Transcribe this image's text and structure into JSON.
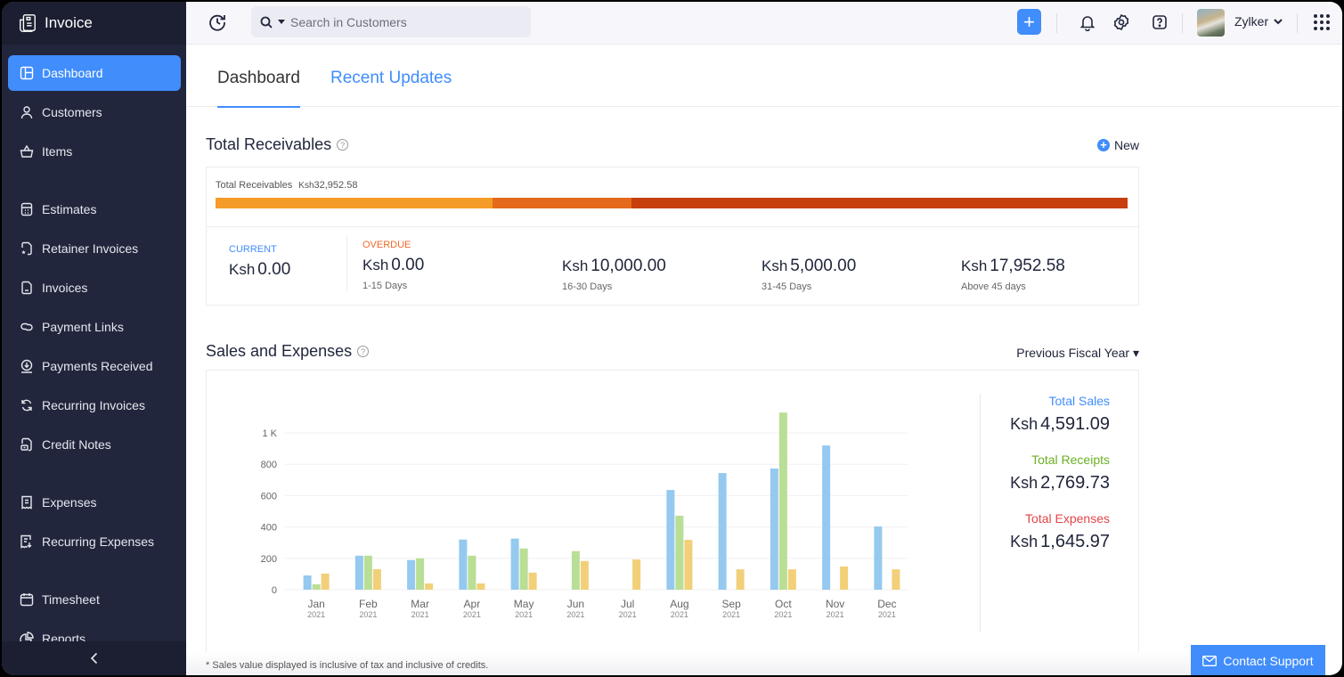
{
  "app": {
    "title": "Invoice"
  },
  "sidebar": {
    "items": [
      {
        "label": "Dashboard",
        "icon": "dashboard-icon",
        "active": true
      },
      {
        "label": "Customers",
        "icon": "user-icon"
      },
      {
        "label": "Items",
        "icon": "basket-icon"
      },
      {
        "label": "Estimates",
        "icon": "calculator-icon"
      },
      {
        "label": "Retainer Invoices",
        "icon": "retainer-invoice-icon"
      },
      {
        "label": "Invoices",
        "icon": "document-icon"
      },
      {
        "label": "Payment Links",
        "icon": "link-icon"
      },
      {
        "label": "Payments Received",
        "icon": "payment-received-icon"
      },
      {
        "label": "Recurring Invoices",
        "icon": "recurring-icon"
      },
      {
        "label": "Credit Notes",
        "icon": "credit-note-icon"
      },
      {
        "label": "Expenses",
        "icon": "receipt-icon"
      },
      {
        "label": "Recurring Expenses",
        "icon": "recurring-receipt-icon"
      },
      {
        "label": "Timesheet",
        "icon": "calendar-icon"
      },
      {
        "label": "Reports",
        "icon": "pie-chart-icon"
      }
    ],
    "collapse_label": "‹"
  },
  "topbar": {
    "search_placeholder": "Search in Customers",
    "org_name": "Zylker",
    "icons": [
      "history-icon",
      "search-icon",
      "plus-icon",
      "bell-icon",
      "gear-icon",
      "help-icon",
      "apps-grid-icon"
    ]
  },
  "tabs": [
    {
      "label": "Dashboard",
      "active": true
    },
    {
      "label": "Recent Updates",
      "active": false
    }
  ],
  "receivables": {
    "title": "Total Receivables",
    "new_label": "New",
    "total_label": "Total Receivables",
    "currency": "Ksh",
    "total_value": "32,952.58",
    "bar_segments": [
      {
        "name": "current-to-30",
        "fraction": 0.304,
        "color": "#f59b28"
      },
      {
        "name": "31-45",
        "fraction": 0.152,
        "color": "#e4691b"
      },
      {
        "name": "above-45",
        "fraction": 0.544,
        "color": "#c63f0c"
      }
    ],
    "current": {
      "label": "CURRENT",
      "currency": "Ksh",
      "value": "0.00",
      "color": "#408dfb"
    },
    "overdue_label": "OVERDUE",
    "overdue_color": "#f06a29",
    "buckets": [
      {
        "currency": "Ksh",
        "value": "0.00",
        "range": "1-15 Days"
      },
      {
        "currency": "Ksh",
        "value": "10,000.00",
        "range": "16-30 Days"
      },
      {
        "currency": "Ksh",
        "value": "5,000.00",
        "range": "31-45 Days"
      },
      {
        "currency": "Ksh",
        "value": "17,952.58",
        "range": "Above 45 days"
      }
    ]
  },
  "sales_expenses": {
    "title": "Sales and Expenses",
    "period": "Previous Fiscal Year ▾",
    "totals": [
      {
        "label": "Total Sales",
        "currency": "Ksh",
        "value": "4,591.09",
        "color": "#408dfb"
      },
      {
        "label": "Total Receipts",
        "currency": "Ksh",
        "value": "2,769.73",
        "color": "#6ab023"
      },
      {
        "label": "Total Expenses",
        "currency": "Ksh",
        "value": "1,645.97",
        "color": "#e5454a"
      }
    ],
    "footnote": "* Sales value displayed is inclusive of tax and inclusive of credits."
  },
  "chart_data": {
    "type": "bar",
    "title": "Sales and Expenses",
    "xlabel": "",
    "ylabel": "",
    "categories": [
      "Jan",
      "Feb",
      "Mar",
      "Apr",
      "May",
      "Jun",
      "Jul",
      "Aug",
      "Sep",
      "Oct",
      "Nov",
      "Dec"
    ],
    "category_sublabels": [
      "2021",
      "2021",
      "2021",
      "2021",
      "2021",
      "2021",
      "2021",
      "2021",
      "2021",
      "2021",
      "2021",
      "2021"
    ],
    "series": [
      {
        "name": "Sales",
        "color": "#95c9ef",
        "values": [
          91,
          217,
          189,
          320,
          326,
          0,
          0,
          636,
          744,
          773,
          920,
          403
        ]
      },
      {
        "name": "Receipts",
        "color": "#b9de95",
        "values": [
          34,
          217,
          200,
          217,
          263,
          246,
          0,
          472,
          0,
          1130,
          0,
          0
        ]
      },
      {
        "name": "Expenses",
        "color": "#f2d079",
        "values": [
          103,
          131,
          40,
          40,
          109,
          183,
          193,
          318,
          130,
          130,
          148,
          130
        ]
      }
    ],
    "yticks": [
      0,
      200,
      400,
      600,
      800,
      1000
    ],
    "ytick_labels": [
      "0",
      "200",
      "400",
      "600",
      "800",
      "1 K"
    ],
    "ylim": [
      0,
      1130
    ],
    "grid": true,
    "legend": "right-panel-totals"
  },
  "support": {
    "label": "Contact Support"
  }
}
